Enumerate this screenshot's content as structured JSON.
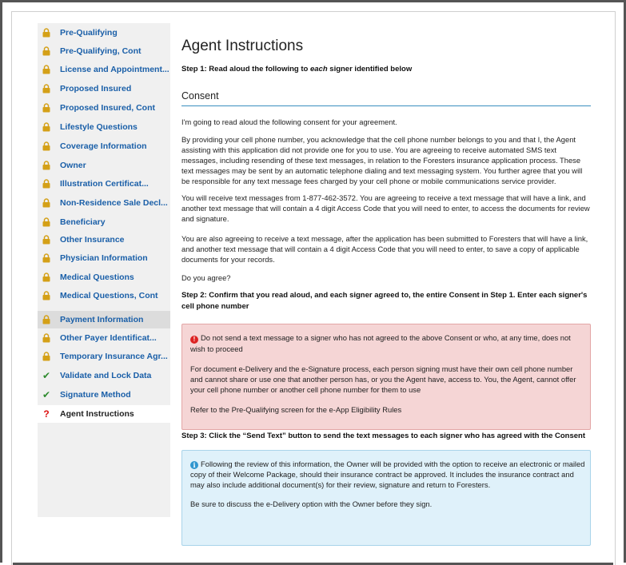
{
  "sidebar": {
    "items": [
      {
        "label": "Pre-Qualifying",
        "status": "locked"
      },
      {
        "label": "Pre-Qualifying, Cont",
        "status": "locked"
      },
      {
        "label": "License and Appointment...",
        "status": "locked"
      },
      {
        "label": "Proposed Insured",
        "status": "locked"
      },
      {
        "label": "Proposed Insured, Cont",
        "status": "locked"
      },
      {
        "label": "Lifestyle Questions",
        "status": "locked"
      },
      {
        "label": "Coverage Information",
        "status": "locked"
      },
      {
        "label": "Owner",
        "status": "locked"
      },
      {
        "label": "Illustration Certificat...",
        "status": "locked"
      },
      {
        "label": "Non-Residence Sale Decl...",
        "status": "locked"
      },
      {
        "label": "Beneficiary",
        "status": "locked"
      },
      {
        "label": "Other Insurance",
        "status": "locked"
      },
      {
        "label": "Physician Information",
        "status": "locked"
      },
      {
        "label": "Medical Questions",
        "status": "locked"
      },
      {
        "label": "Medical Questions, Cont",
        "status": "locked"
      },
      {
        "label": "Payment Information",
        "status": "locked"
      },
      {
        "label": "Other Payer Identificat...",
        "status": "locked"
      },
      {
        "label": "Temporary Insurance Agr...",
        "status": "locked"
      },
      {
        "label": "Validate and Lock Data",
        "status": "complete"
      },
      {
        "label": "Signature Method",
        "status": "complete"
      },
      {
        "label": "Agent Instructions",
        "status": "incomplete"
      }
    ]
  },
  "main": {
    "title": "Agent Instructions",
    "step1_prefix": "Step 1: Read aloud the following to ",
    "step1_emph": "each",
    "step1_suffix": " signer identified below",
    "consent_heading": "Consent",
    "p1": "I'm going to read aloud the following consent for your agreement.",
    "p2": "By providing your cell phone number, you acknowledge that the cell phone number belongs to you and that I, the Agent assisting with this application did not provide one for you to use. You are agreeing to receive automated SMS text messages, including resending of these text messages, in relation to the Foresters insurance application process. These text messages may be sent by an automatic telephone dialing and text messaging system. You further agree that you will be responsible for any text message fees charged by your cell phone or mobile communications service provider.",
    "p3": "You will receive text messages from 1-877-462-3572. You are agreeing to receive a text message that will have a link, and another text message that will contain a 4 digit Access Code that you will need to enter, to access the documents for review and signature.",
    "p4": "You are also agreeing to receive a text message, after the application has been submitted to Foresters that will have a link, and another text message that will contain a 4 digit Access Code that you will need to enter, to save a copy of applicable documents for your records.",
    "p5": "Do you agree?",
    "step2": "Step 2: Confirm that you read aloud, and each signer agreed to, the entire Consent in Step 1. Enter each signer's cell phone number",
    "warn1": "Do not send a text message to a signer who has not agreed to the above Consent or who, at any time, does not wish to proceed",
    "warn2": "For document e-Delivery and the e-Signature process, each person signing must have their own cell phone number and cannot share or use one that another person has, or you the Agent have, access to. You, the Agent, cannot offer your cell phone number or another cell phone number for them to use",
    "warn3": "Refer to the Pre-Qualifying screen for the e-App Eligibility Rules",
    "step3": "Step 3: Click the “Send Text” button to send the text messages to each signer who has agreed with the Consent",
    "info1": "Following the review of this information, the Owner will be provided with the option to receive an electronic or mailed copy of their Welcome Package, should their insurance contract be approved. It includes the insurance contract and may also include additional document(s) for their review, signature and return to Foresters.",
    "info2": "Be sure to discuss the e-Delivery option with the Owner before they sign."
  },
  "colors": {
    "link": "#1a5fa8",
    "lock": "#d4a017",
    "check": "#2e8b2e",
    "question": "#dd1111",
    "danger_bg": "#f5d5d5",
    "info_bg": "#dff1fa",
    "rule": "#3a8fbf"
  }
}
